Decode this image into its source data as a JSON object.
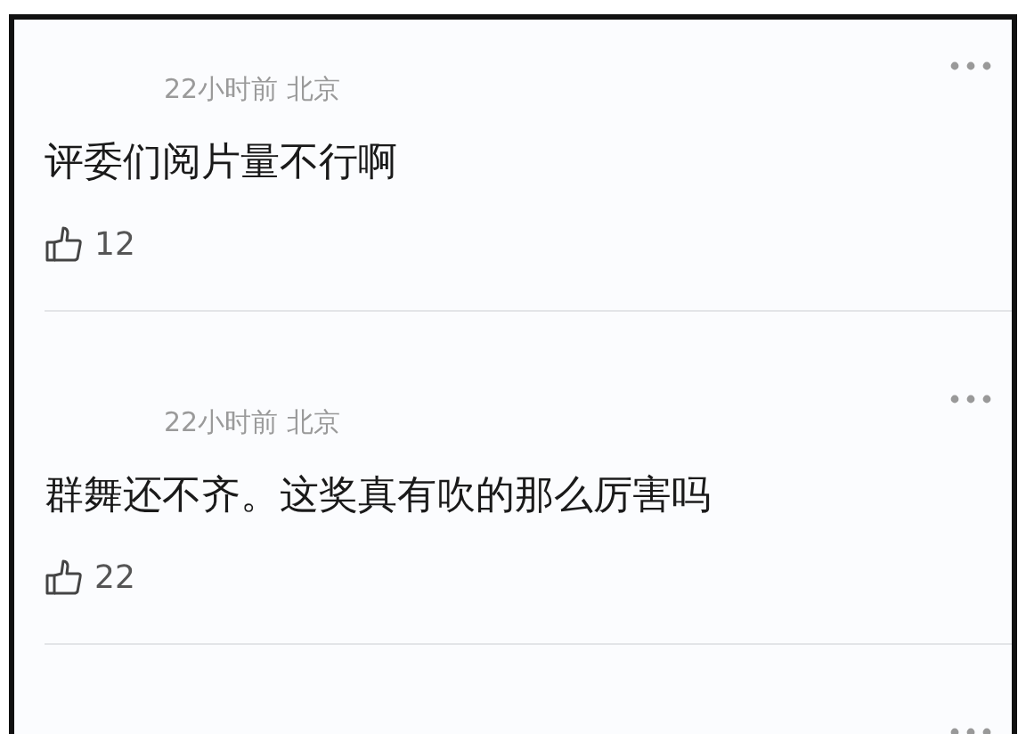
{
  "comments": [
    {
      "kind": "full",
      "time": "22小时前 北京",
      "text": "评委们阅片量不行啊",
      "likes": "12"
    },
    {
      "kind": "full",
      "time": "22小时前 北京",
      "text": "群舞还不齐。这奖真有吹的那么厉害吗",
      "likes": "22"
    },
    {
      "kind": "partial"
    }
  ]
}
